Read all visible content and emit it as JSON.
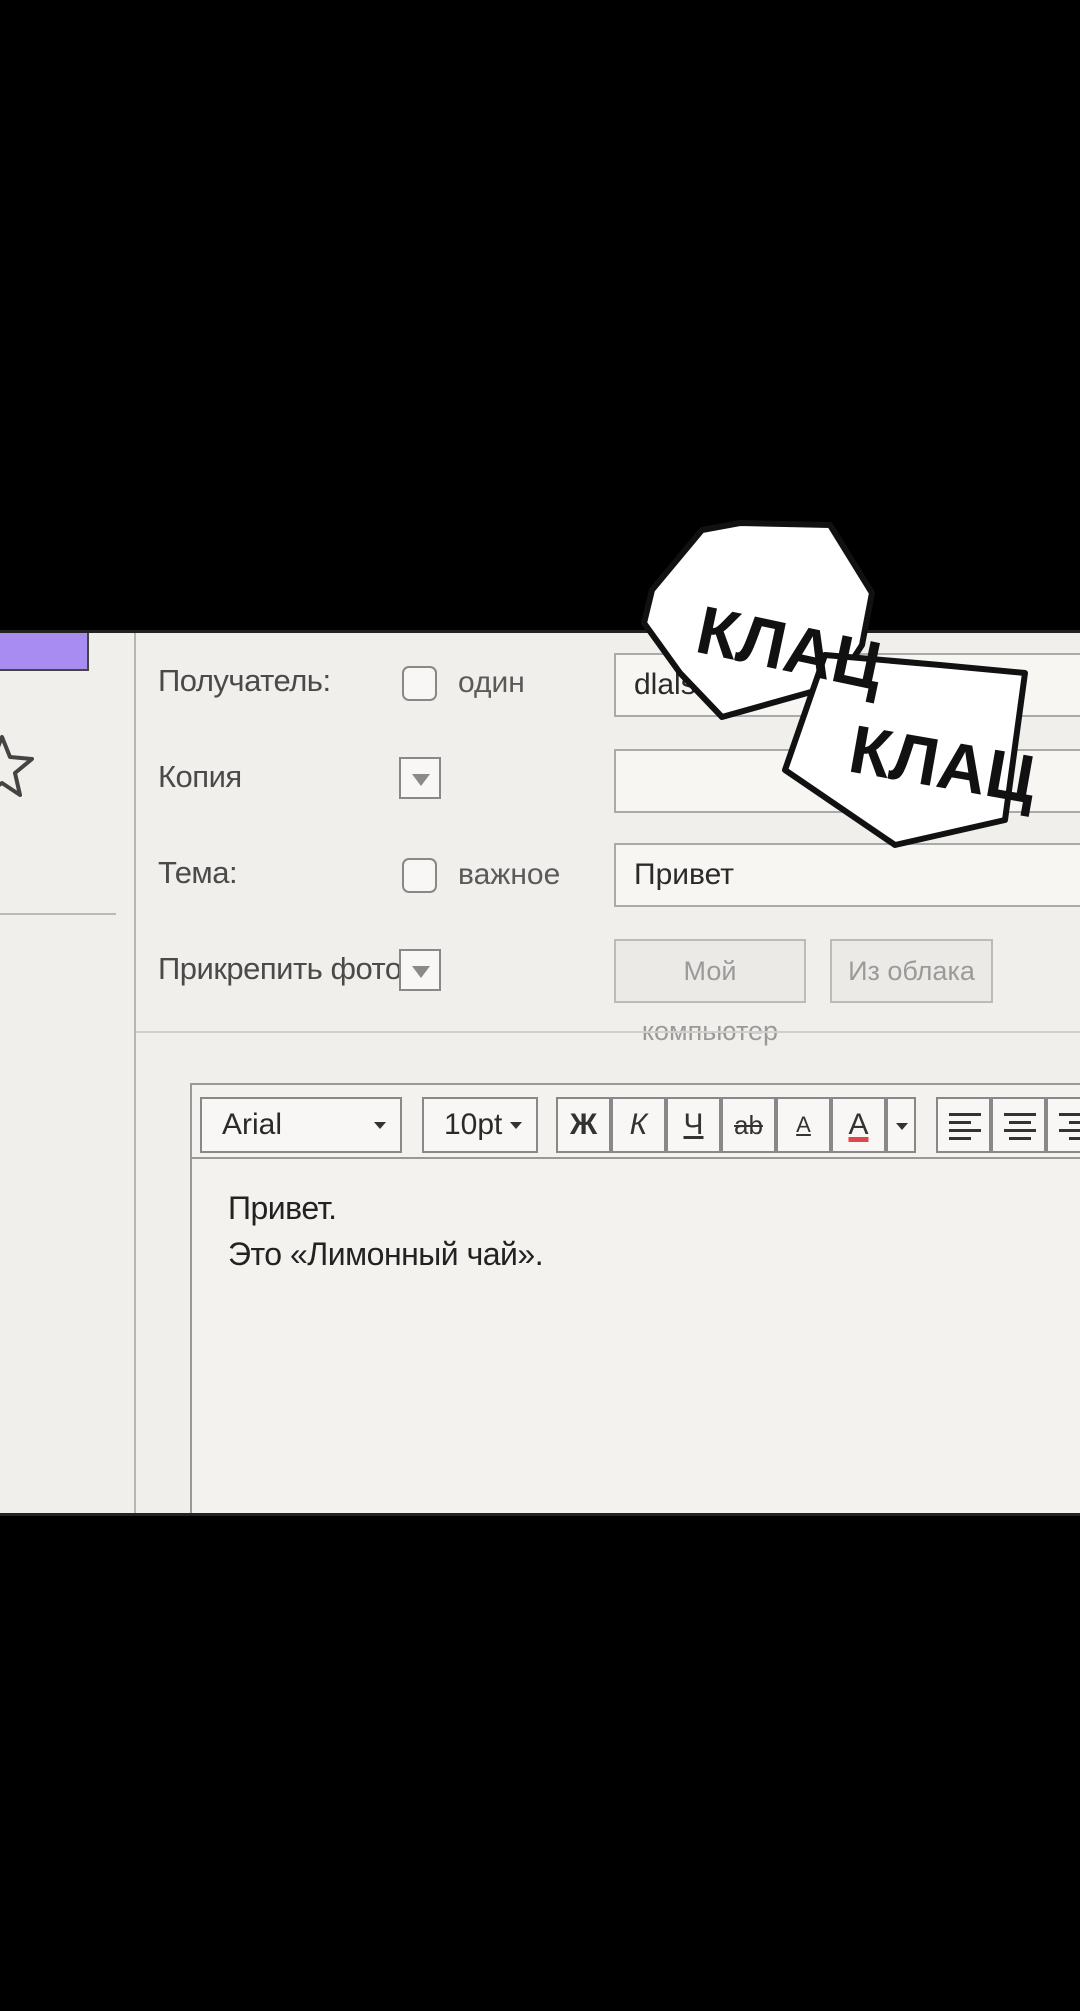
{
  "form": {
    "recipient_label": "Получатель:",
    "recipient_option": "один",
    "recipient_value": "dlals",
    "cc_label": "Копия",
    "subject_label": "Тема:",
    "subject_option": "важное",
    "subject_value": "Привет",
    "attach_label": "Прикрепить фото",
    "attach_computer": "Мой компьютер",
    "attach_cloud": "Из облака"
  },
  "toolbar": {
    "font": "Arial",
    "size": "10pt",
    "bold": "Ж",
    "italic": "К",
    "underline": "Ч",
    "strike": "ab",
    "spacing": "A",
    "color": "A"
  },
  "body": {
    "line1": "Привет.",
    "line2": "Это «Лимонный чай»."
  },
  "sfx": {
    "word1": "КЛАЦ",
    "word2": "КЛАЦ"
  },
  "colors": {
    "accent": "#a88cf2",
    "text_color_underline": "#e0474c"
  },
  "icons": [
    "star-icon",
    "chevron-down-icon",
    "align-left-icon",
    "align-center-icon",
    "align-right-icon"
  ]
}
